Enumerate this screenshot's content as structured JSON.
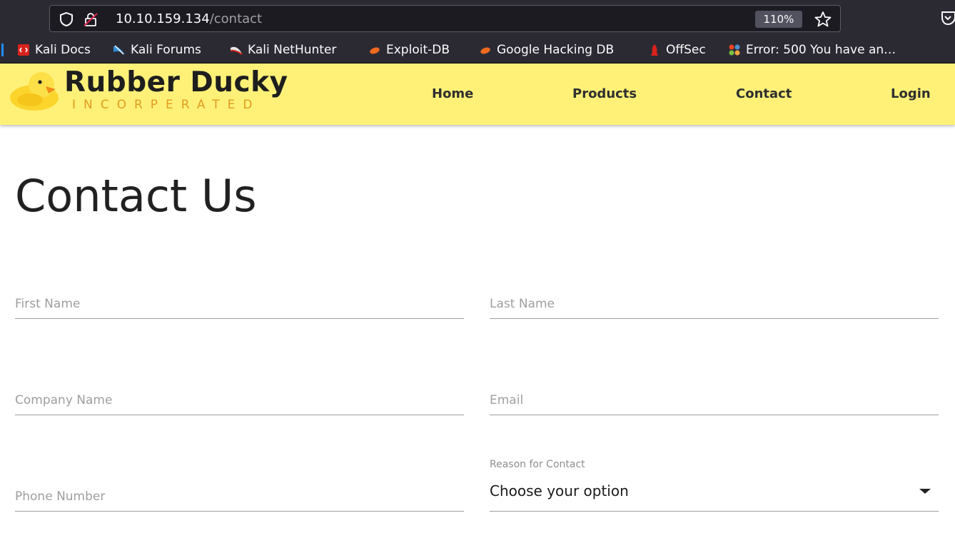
{
  "browser": {
    "url_host": "10.10.159.134",
    "url_path": "/contact",
    "zoom": "110%",
    "bookmarks": [
      {
        "label": "Kali Docs",
        "icon": "kali-docs-icon"
      },
      {
        "label": "Kali Forums",
        "icon": "kali-forums-icon"
      },
      {
        "label": "Kali NetHunter",
        "icon": "kali-nethunter-icon"
      },
      {
        "label": "Exploit-DB",
        "icon": "exploit-db-icon"
      },
      {
        "label": "Google Hacking DB",
        "icon": "google-hacking-db-icon"
      },
      {
        "label": "OffSec",
        "icon": "offsec-icon"
      },
      {
        "label": "Error: 500 You have an…",
        "icon": "joomla-icon"
      }
    ]
  },
  "site": {
    "brand_title": "Rubber Ducky",
    "brand_subtitle": "INCORPERATED",
    "nav": [
      "Home",
      "Products",
      "Contact",
      "Login"
    ],
    "header_color": "#fff178",
    "accent_color": "#e39b21"
  },
  "form": {
    "title": "Contact Us",
    "first_name_placeholder": "First Name",
    "last_name_placeholder": "Last Name",
    "company_placeholder": "Company Name",
    "email_placeholder": "Email",
    "phone_placeholder": "Phone Number",
    "reason_label": "Reason for Contact",
    "reason_value": "Choose your option"
  }
}
